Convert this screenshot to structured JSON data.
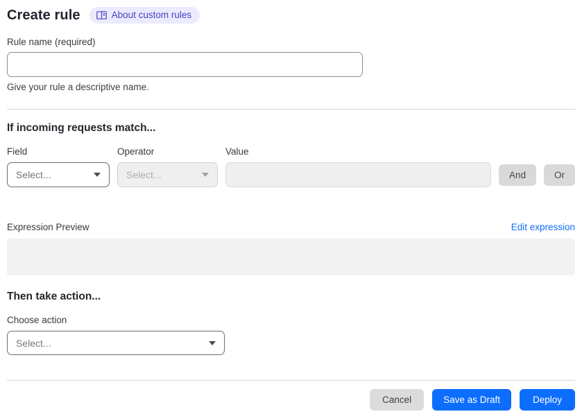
{
  "header": {
    "title": "Create rule",
    "about_badge_label": "About custom rules"
  },
  "rule_name": {
    "label": "Rule name (required)",
    "value": "",
    "helper": "Give your rule a descriptive name."
  },
  "match_section": {
    "heading": "If incoming requests match...",
    "field": {
      "label": "Field",
      "placeholder": "Select..."
    },
    "operator": {
      "label": "Operator",
      "placeholder": "Select..."
    },
    "value": {
      "label": "Value",
      "value": ""
    },
    "and_button_label": "And",
    "or_button_label": "Or",
    "expression_preview_label": "Expression Preview",
    "edit_expression_link": "Edit expression",
    "expression_preview_value": ""
  },
  "action_section": {
    "heading": "Then take action...",
    "choose_action_label": "Choose action",
    "action_placeholder": "Select..."
  },
  "footer": {
    "cancel_label": "Cancel",
    "save_draft_label": "Save as Draft",
    "deploy_label": "Deploy"
  },
  "colors": {
    "primary_blue": "#0d6efd",
    "link_blue": "#0d6efd",
    "badge_bg": "#ecebfd",
    "badge_text": "#4540c2",
    "disabled_bg": "#efefef",
    "gray_button_bg": "#d9d9d9",
    "preview_box_bg": "#f2f2f2",
    "divider": "#d8d8d8"
  }
}
